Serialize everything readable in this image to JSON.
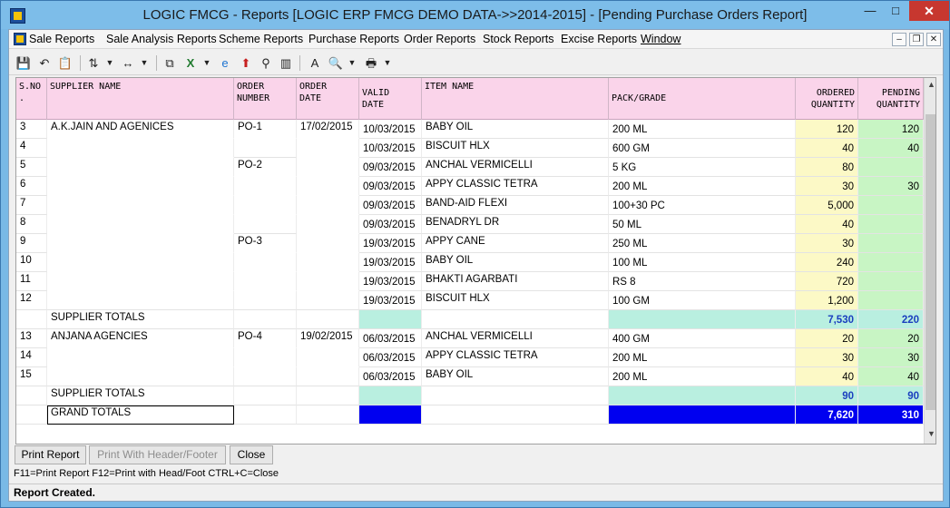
{
  "window": {
    "title": "LOGIC FMCG - Reports  [LOGIC ERP FMCG DEMO DATA->>2014-2015] - [Pending Purchase Orders Report]",
    "min_glyph": "—",
    "max_glyph": "□",
    "close_glyph": "✕"
  },
  "menu": {
    "items": [
      "Sale Reports",
      "Sale Analysis Reports",
      "Scheme Reports",
      "Purchase Reports",
      "Order Reports",
      "Stock Reports",
      "Excise Reports",
      "Window"
    ],
    "mdi_min": "–",
    "mdi_restore": "❐",
    "mdi_close": "✕"
  },
  "toolbar": {
    "icons": [
      "save-icon",
      "undo-icon",
      "export-icon",
      "sort-icon",
      "column-width-icon",
      "copy-icon",
      "excel-icon",
      "browser-icon",
      "upload-icon",
      "find-icon",
      "chart-icon",
      "font-icon",
      "print-preview-icon",
      "print-icon"
    ]
  },
  "grid": {
    "columns": [
      "S.NO\n.",
      "SUPPLIER NAME",
      "ORDER\nNUMBER",
      "ORDER\nDATE",
      "VALID\nDATE",
      "ITEM NAME",
      "PACK/GRADE",
      "ORDERED\nQUANTITY",
      "PENDING\nQUANTITY"
    ],
    "rows": [
      {
        "sno": "3",
        "supplier": "A.K.JAIN AND AGENICES",
        "order_no": "PO-1",
        "order_date": "17/02/2015",
        "valid_date": "10/03/2015",
        "item": "BABY OIL",
        "pack": "200 ML",
        "ordered": "120",
        "pending": "120"
      },
      {
        "sno": "4",
        "supplier": "",
        "order_no": "",
        "order_date": "",
        "valid_date": "10/03/2015",
        "item": "BISCUIT HLX",
        "pack": "600 GM",
        "ordered": "40",
        "pending": "40"
      },
      {
        "sno": "5",
        "supplier": "",
        "order_no": "PO-2",
        "order_date": "",
        "valid_date": "09/03/2015",
        "item": "ANCHAL VERMICELLI",
        "pack": "5 KG",
        "ordered": "80",
        "pending": ""
      },
      {
        "sno": "6",
        "supplier": "",
        "order_no": "",
        "order_date": "",
        "valid_date": "09/03/2015",
        "item": "APPY CLASSIC TETRA",
        "pack": "200 ML",
        "ordered": "30",
        "pending": "30"
      },
      {
        "sno": "7",
        "supplier": "",
        "order_no": "",
        "order_date": "",
        "valid_date": "09/03/2015",
        "item": "BAND-AID FLEXI",
        "pack": "100+30 PC",
        "ordered": "5,000",
        "pending": ""
      },
      {
        "sno": "8",
        "supplier": "",
        "order_no": "",
        "order_date": "",
        "valid_date": "09/03/2015",
        "item": "BENADRYL DR",
        "pack": "50 ML",
        "ordered": "40",
        "pending": ""
      },
      {
        "sno": "9",
        "supplier": "",
        "order_no": "PO-3",
        "order_date": "",
        "valid_date": "19/03/2015",
        "item": "APPY CANE",
        "pack": "250 ML",
        "ordered": "30",
        "pending": ""
      },
      {
        "sno": "10",
        "supplier": "",
        "order_no": "",
        "order_date": "",
        "valid_date": "19/03/2015",
        "item": "BABY OIL",
        "pack": "100 ML",
        "ordered": "240",
        "pending": ""
      },
      {
        "sno": "11",
        "supplier": "",
        "order_no": "",
        "order_date": "",
        "valid_date": "19/03/2015",
        "item": "BHAKTI AGARBATI",
        "pack": "RS 8",
        "ordered": "720",
        "pending": ""
      },
      {
        "sno": "12",
        "supplier": "",
        "order_no": "",
        "order_date": "",
        "valid_date": "19/03/2015",
        "item": "BISCUIT HLX",
        "pack": "100 GM",
        "ordered": "1,200",
        "pending": ""
      },
      {
        "type": "subtotal",
        "label": "SUPPLIER TOTALS",
        "ordered": "7,530",
        "pending": "220"
      },
      {
        "sno": "13",
        "supplier": "ANJANA AGENCIES",
        "order_no": "PO-4",
        "order_date": "19/02/2015",
        "valid_date": "06/03/2015",
        "item": "ANCHAL VERMICELLI",
        "pack": "400 GM",
        "ordered": "20",
        "pending": "20"
      },
      {
        "sno": "14",
        "supplier": "",
        "order_no": "",
        "order_date": "",
        "valid_date": "06/03/2015",
        "item": "APPY CLASSIC TETRA",
        "pack": "200 ML",
        "ordered": "30",
        "pending": "30"
      },
      {
        "sno": "15",
        "supplier": "",
        "order_no": "",
        "order_date": "",
        "valid_date": "06/03/2015",
        "item": "BABY OIL",
        "pack": "200 ML",
        "ordered": "40",
        "pending": "40"
      },
      {
        "type": "subtotal",
        "label": "SUPPLIER TOTALS",
        "ordered": "90",
        "pending": "90"
      },
      {
        "type": "grand",
        "label": "GRAND TOTALS",
        "ordered": "7,620",
        "pending": "310"
      }
    ],
    "colors": {
      "ordered_bg": "#fcf9c6",
      "pending_bg": "#c8f5c4",
      "total_bg": "#b9efe0",
      "grand_bg": "#0000f0",
      "header_bg": "#fad4ea"
    }
  },
  "buttons": {
    "print_report": "Print Report",
    "print_header_footer": "Print With Header/Footer",
    "close": "Close"
  },
  "shortcut_hint": "F11=Print Report  F12=Print with Head/Foot  CTRL+C=Close",
  "status": "Report Created."
}
